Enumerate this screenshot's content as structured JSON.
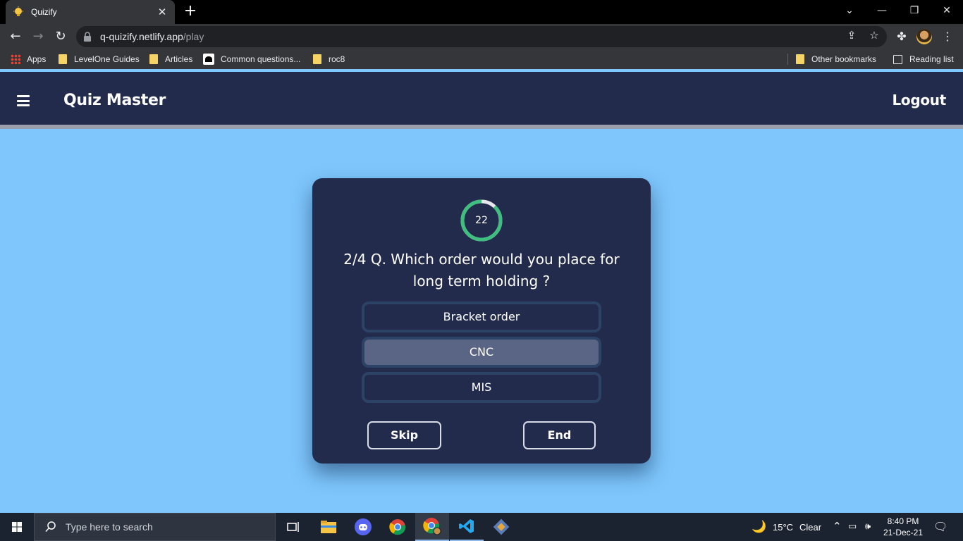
{
  "browser": {
    "tab_title": "Quizify",
    "url_host": "q-quizify.netlify.app",
    "url_path": "/play",
    "bookmarks": [
      {
        "label": "Apps"
      },
      {
        "label": "LevelOne Guides"
      },
      {
        "label": "Articles"
      },
      {
        "label": "Common questions..."
      },
      {
        "label": "roc8"
      }
    ],
    "other_bookmarks": "Other bookmarks",
    "reading_list": "Reading list"
  },
  "app": {
    "brand": "Quiz Master",
    "logout": "Logout"
  },
  "quiz": {
    "timer": "22",
    "timer_fraction_remaining": 0.88,
    "question": "2/4 Q. Which order would you place for long term holding ?",
    "options": [
      {
        "label": "Bracket order",
        "selected": false
      },
      {
        "label": "CNC",
        "selected": true
      },
      {
        "label": "MIS",
        "selected": false
      }
    ],
    "skip": "Skip",
    "end": "End"
  },
  "taskbar": {
    "search_placeholder": "Type here to search",
    "weather": "15°C",
    "weather_desc": "Clear",
    "time": "8:40 PM",
    "date": "21-Dec-21"
  },
  "colors": {
    "page_bg": "#7ec6fc",
    "appbar": "#232b4c",
    "card": "#232b4c",
    "timer_ring": "#3fbf7f",
    "option_border": "#2c4266",
    "option_selected": "#5a6484"
  }
}
